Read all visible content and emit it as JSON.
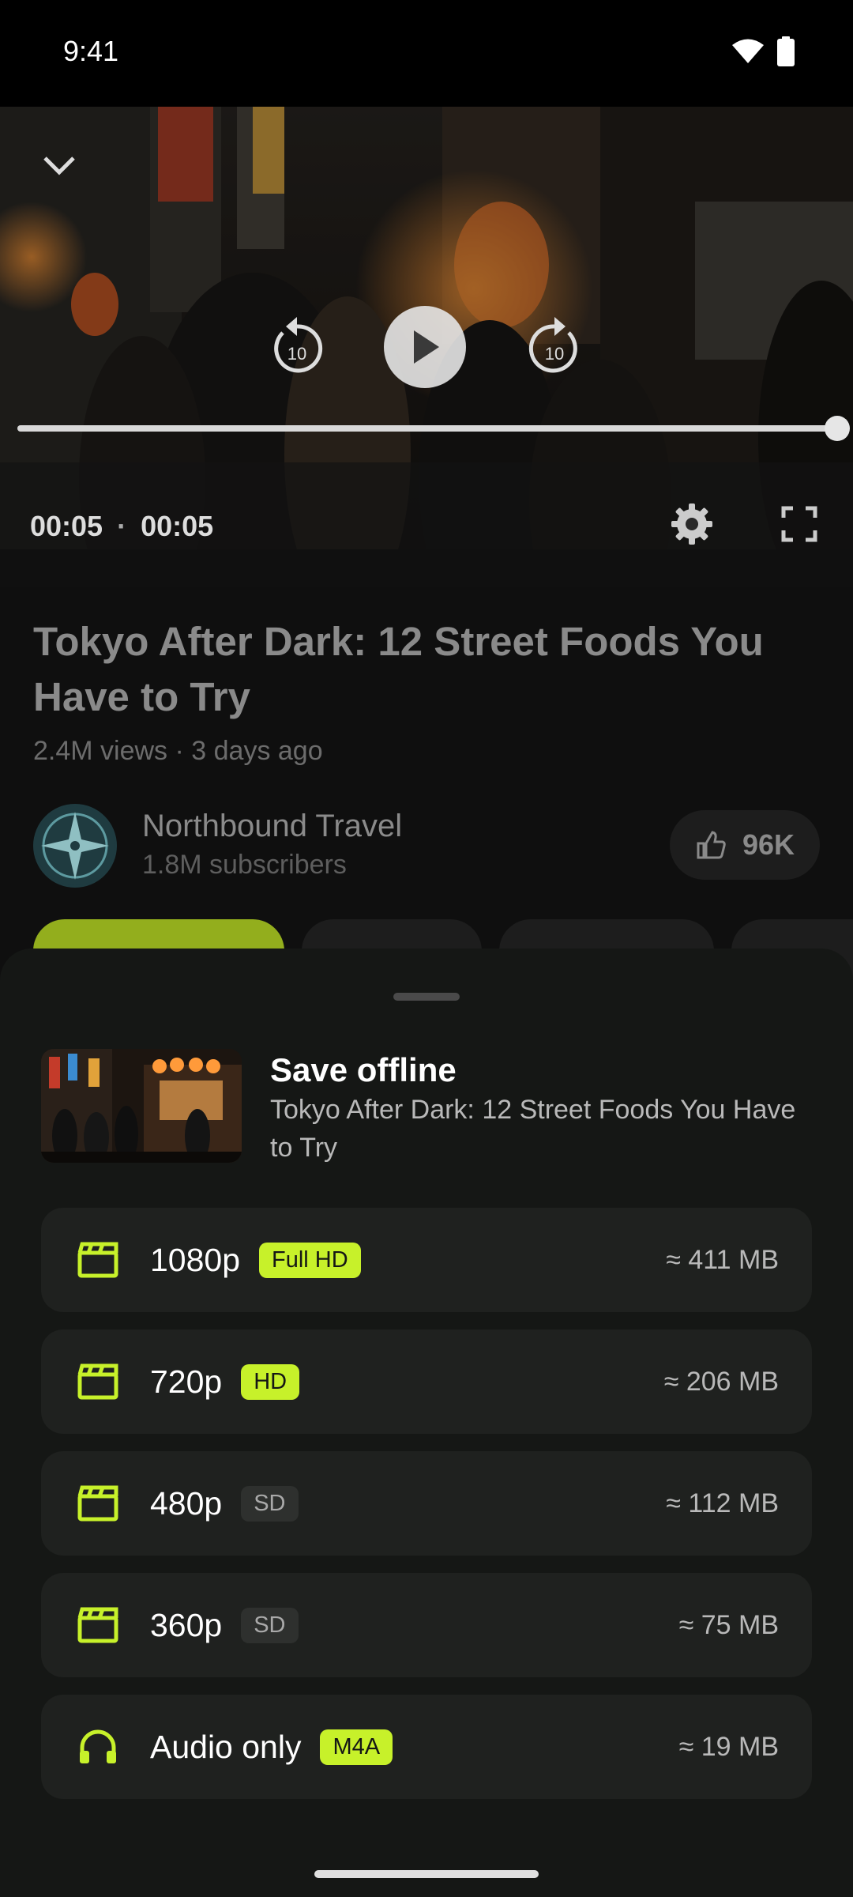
{
  "status_bar": {
    "time": "9:41",
    "icons": [
      "wifi-icon",
      "battery-icon"
    ]
  },
  "player": {
    "elapsed": "00:05",
    "separator": "·",
    "duration": "00:05",
    "progress": 1.0,
    "rewind_seconds": "10",
    "forward_seconds": "10",
    "icons": [
      "chevron-down-icon",
      "replay-10-icon",
      "play-icon",
      "forward-10-icon",
      "settings-gear-icon",
      "fullscreen-icon"
    ]
  },
  "video": {
    "title": "Tokyo After Dark: 12 Street Foods You Have to Try",
    "meta": "2.4M views · 3 days ago",
    "channel_name": "Northbound Travel",
    "channel_subs": "1.8M subscribers",
    "likes": "96K"
  },
  "sheet": {
    "title": "Save offline",
    "subtitle": "Tokyo After Dark: 12 Street Foods You Have to Try",
    "options": [
      {
        "label": "1080p",
        "badge": "Full HD",
        "badge_style": "accent",
        "size": "≈ 411 MB",
        "icon": "clapperboard-icon"
      },
      {
        "label": "720p",
        "badge": "HD",
        "badge_style": "accent",
        "size": "≈ 206 MB",
        "icon": "clapperboard-icon"
      },
      {
        "label": "480p",
        "badge": "SD",
        "badge_style": "muted",
        "size": "≈ 112 MB",
        "icon": "clapperboard-icon"
      },
      {
        "label": "360p",
        "badge": "SD",
        "badge_style": "muted",
        "size": "≈ 75 MB",
        "icon": "clapperboard-icon"
      },
      {
        "label": "Audio only",
        "badge": "M4A",
        "badge_style": "accent",
        "size": "≈ 19 MB",
        "icon": "headphones-icon"
      }
    ]
  },
  "colors": {
    "accent": "#c7f12a",
    "sheet_bg": "#151715",
    "card_bg": "#1f211f"
  }
}
